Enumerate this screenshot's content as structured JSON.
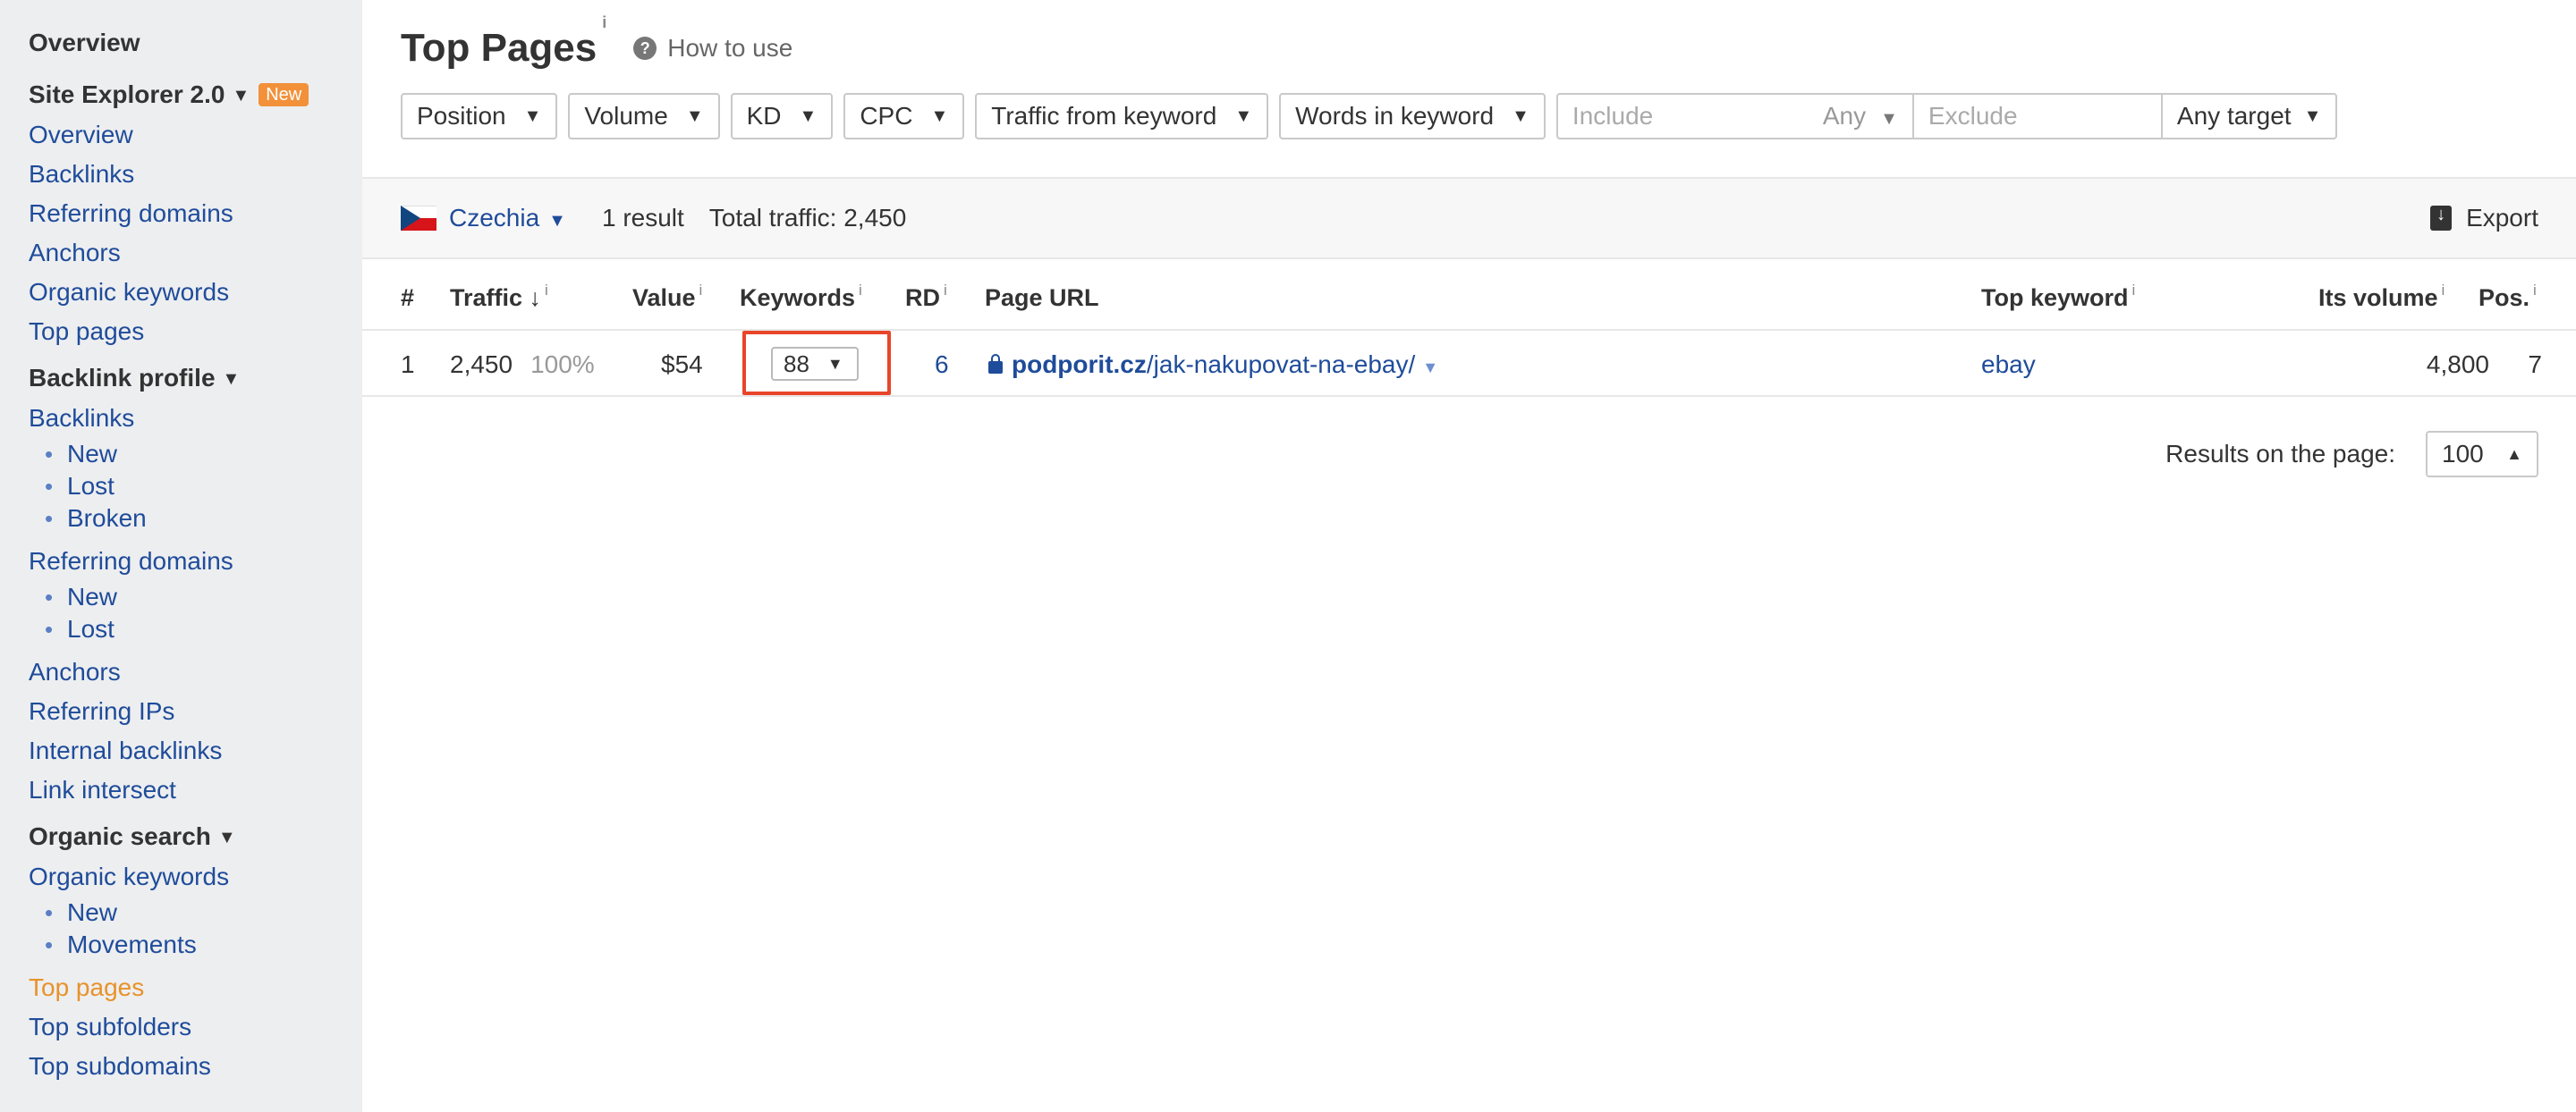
{
  "sidebar": {
    "overview_heading": "Overview",
    "site_explorer": {
      "label": "Site Explorer 2.0",
      "badge": "New"
    },
    "site_items": [
      "Overview",
      "Backlinks",
      "Referring domains",
      "Anchors",
      "Organic keywords",
      "Top pages"
    ],
    "backlink_profile": {
      "label": "Backlink profile",
      "backlinks": "Backlinks",
      "backlinks_sub": [
        "New",
        "Lost",
        "Broken"
      ],
      "referring_domains": "Referring domains",
      "referring_domains_sub": [
        "New",
        "Lost"
      ],
      "other_items": [
        "Anchors",
        "Referring IPs",
        "Internal backlinks",
        "Link intersect"
      ]
    },
    "organic_search": {
      "label": "Organic search",
      "organic_keywords": "Organic keywords",
      "organic_keywords_sub": [
        "New",
        "Movements"
      ],
      "items": [
        "Top pages",
        "Top subfolders",
        "Top subdomains"
      ]
    }
  },
  "header": {
    "title": "Top Pages",
    "info": "i",
    "how_to": "How to use",
    "help_icon": "?"
  },
  "filters": {
    "buttons": [
      "Position",
      "Volume",
      "KD",
      "CPC",
      "Traffic from keyword",
      "Words in keyword"
    ],
    "include_placeholder": "Include",
    "include_mode": "Any",
    "exclude_placeholder": "Exclude",
    "target": "Any target"
  },
  "summary": {
    "country": "Czechia",
    "results": "1 result",
    "total_traffic": "Total traffic: 2,450",
    "export": "Export"
  },
  "table": {
    "headers": {
      "num": "#",
      "traffic": "Traffic",
      "value": "Value",
      "keywords": "Keywords",
      "rd": "RD",
      "page_url": "Page URL",
      "top_keyword": "Top keyword",
      "its_volume": "Its volume",
      "pos": "Pos."
    },
    "sort_arrow": "↓",
    "info": "i",
    "rows": [
      {
        "num": "1",
        "traffic": "2,450",
        "traffic_pct": "100%",
        "value": "$54",
        "keywords": "88",
        "rd": "6",
        "url_domain": "podporit.cz",
        "url_path": "/jak-nakupovat-na-ebay/",
        "top_keyword": "ebay",
        "its_volume": "4,800",
        "pos": "7"
      }
    ]
  },
  "pagination": {
    "label": "Results on the page:",
    "value": "100"
  },
  "colors": {
    "sidebar_bg": "#edeef0",
    "link": "#1f4c9a",
    "active": "#e8922a",
    "badge": "#f2913a",
    "highlight": "#e8452a"
  }
}
